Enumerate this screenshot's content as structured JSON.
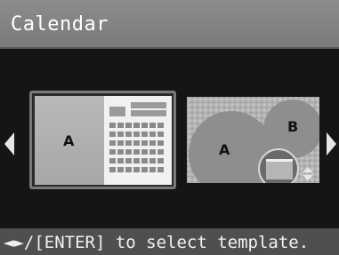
{
  "header": {
    "title": "Calendar"
  },
  "navigation": {
    "prev_icon": "triangle-left-icon",
    "next_icon": "triangle-right-icon"
  },
  "templates": [
    {
      "selected": true,
      "photo_labels": [
        "A"
      ]
    },
    {
      "selected": false,
      "photo_labels": [
        "A",
        "B"
      ]
    }
  ],
  "footer": {
    "hint": "◄►/[ENTER] to select template."
  },
  "colors": {
    "title_bar": "#808080",
    "background": "#151515",
    "footer_bar": "#4f4f4f",
    "text": "#ffffff"
  }
}
